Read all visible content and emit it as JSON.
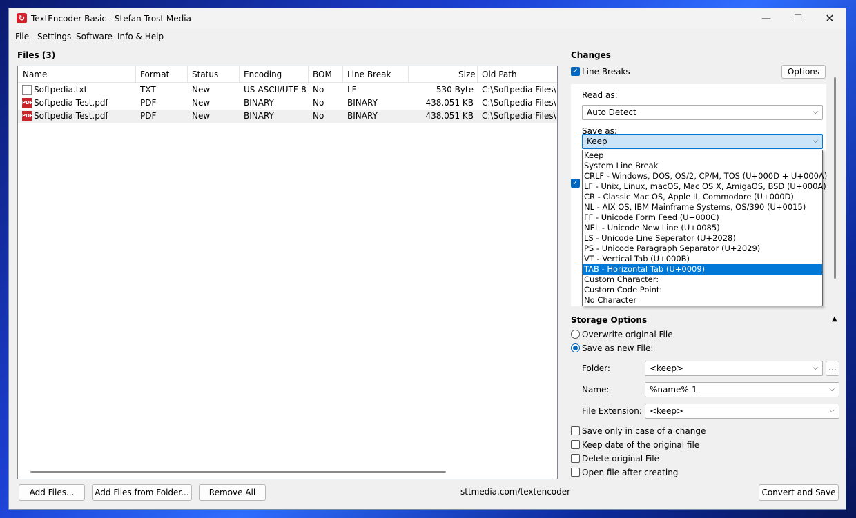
{
  "window": {
    "title": "TextEncoder Basic - Stefan Trost Media",
    "icon": "app-logo-icon"
  },
  "menu": [
    "File",
    "Settings",
    "Software",
    "Info & Help"
  ],
  "files": {
    "title": "Files (3)",
    "columns": [
      "Name",
      "Format",
      "Status",
      "Encoding",
      "BOM",
      "Line Break",
      "Size",
      "Old Path"
    ],
    "rows": [
      {
        "name": "Softpedia.txt",
        "format": "TXT",
        "status": "New",
        "encoding": "US-ASCII/UTF-8",
        "bom": "No",
        "linebreak": "LF",
        "size": "530 Byte",
        "path": "C:\\Softpedia Files\\Sc"
      },
      {
        "name": "Softpedia Test.pdf",
        "format": "PDF",
        "status": "New",
        "encoding": "BINARY",
        "bom": "No",
        "linebreak": "BINARY",
        "size": "438.051 KB",
        "path": "C:\\Softpedia Files\\Sc"
      },
      {
        "name": "Softpedia Test.pdf",
        "format": "PDF",
        "status": "New",
        "encoding": "BINARY",
        "bom": "No",
        "linebreak": "BINARY",
        "size": "438.051 KB",
        "path": "C:\\Softpedia Files\\Sc"
      }
    ],
    "icons": [
      "text-file-icon",
      "pdf-file-icon"
    ],
    "pdf_badge": "PDF"
  },
  "buttons": {
    "add_files": "Add Files...",
    "add_folder": "Add Files from Folder...",
    "remove_all": "Remove All",
    "convert": "Convert and Save",
    "options": "Options",
    "browse": "..."
  },
  "footer_link": "sttmedia.com/textencoder",
  "changes": {
    "title": "Changes",
    "line_breaks_label": "Line Breaks",
    "read_as_label": "Read as:",
    "read_as_value": "Auto Detect",
    "save_as_label": "Save as:",
    "save_as_value": "Keep",
    "options": [
      "Keep",
      "System Line Break",
      "CRLF - Windows, DOS, OS/2, CP/M, TOS (U+000D + U+000A)",
      "LF - Unix, Linux, macOS, Mac OS X, AmigaOS, BSD (U+000A)",
      "CR - Classic Mac OS, Apple II, Commodore (U+000D)",
      "NL - AIX OS, IBM Mainframe Systems, OS/390 (U+0015)",
      "FF - Unicode Form Feed (U+000C)",
      "NEL - Unicode New Line (U+0085)",
      "LS - Unicode Line Seperator (U+2028)",
      "PS - Unicode Paragraph Separator (U+2029)",
      "VT - Vertical Tab (U+000B)",
      "TAB - Horizontal Tab (U+0009)",
      "Custom Character:",
      "Custom Code Point:",
      "No Character"
    ],
    "highlighted_option": "TAB - Horizontal Tab (U+0009)"
  },
  "storage": {
    "title": "Storage Options",
    "overwrite_label": "Overwrite original File",
    "save_new_label": "Save as new File:",
    "folder_label": "Folder:",
    "folder_value": "<keep>",
    "name_label": "Name:",
    "name_value": "%name%-1",
    "ext_label": "File Extension:",
    "ext_value": "<keep>",
    "opt_change": "Save only in case of a change",
    "opt_date": "Keep date of the original file",
    "opt_delete": "Delete original File",
    "opt_open": "Open file after creating"
  },
  "colors": {
    "accent": "#0067c0",
    "selection": "#0078d7",
    "pdf_red": "#c8242b"
  }
}
